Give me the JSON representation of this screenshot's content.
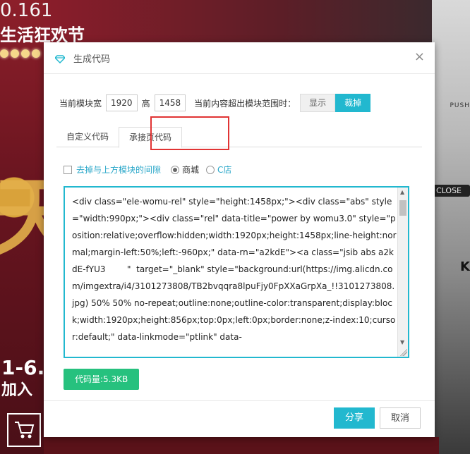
{
  "background": {
    "banner_line1": "0.161",
    "banner_line2": "生活狂欢节",
    "big_glyph": "天",
    "date_text": "1-6.",
    "join_text": "加入",
    "push_text": "PUSH",
    "close_text": "CLOSE",
    "k_text": "K"
  },
  "dialog": {
    "title": "生成代码",
    "close_glyph": "×",
    "size_row": {
      "width_label": "当前模块宽",
      "width_value": "1920",
      "height_label": "高",
      "height_value": "1458",
      "overflow_label": "当前内容超出模块范围时：",
      "show_label": "显示",
      "crop_label": "裁掉"
    },
    "tabs": [
      {
        "label": "自定义代码"
      },
      {
        "label": "承接页代码"
      }
    ],
    "options": {
      "remove_gap_label": "去掉与上方模块的间隙",
      "radio_mall": "商城",
      "radio_cshop": "C店"
    },
    "code_text": "<div class=\"ele-womu-rel\" style=\"height:1458px;\"><div class=\"abs\" style=\"width:990px;\"><div class=\"rel\" data-title=\"power by womu3.0\" style=\"position:relative;overflow:hidden;width:1920px;height:1458px;line-height:normal;margin-left:50%;left:-960px;\" data-rn=\"a2kdE\"><a class=\"jsib abs a2kdE-fYU3        \"  target=\"_blank\" style=\"background:url(https://img.alicdn.com/imgextra/i4/3101273808/TB2bvqqra8lpuFjy0FpXXaGrpXa_!!3101273808.jpg) 50% 50% no-repeat;outline:none;outline-color:transparent;display:block;width:1920px;height:856px;top:0px;left:0px;border:none;z-index:10;cursor:default;\" data-linkmode=\"ptlink\" data-",
    "code_size": "代码量:5.3KB",
    "share_label": "分享",
    "cancel_label": "取消"
  },
  "colors": {
    "accent": "#22b8cf",
    "green": "#26c17e",
    "highlight_red": "#e13434"
  }
}
